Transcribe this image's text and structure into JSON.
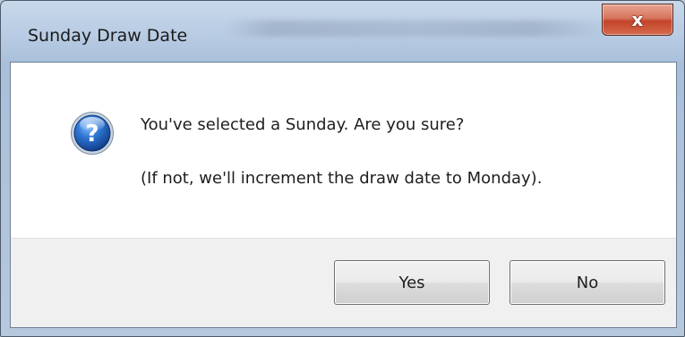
{
  "dialog": {
    "title": "Sunday Draw Date",
    "close_label": "x",
    "icon": "question-icon",
    "message_line1": "You've selected a Sunday. Are you sure?",
    "message_line2": "(If not, we'll increment the draw date to Monday).",
    "buttons": {
      "yes": "Yes",
      "no": "No"
    },
    "colors": {
      "close_button": "#c2442a",
      "icon_blue": "#1f5fb4",
      "footer": "#f0f0f0"
    }
  }
}
